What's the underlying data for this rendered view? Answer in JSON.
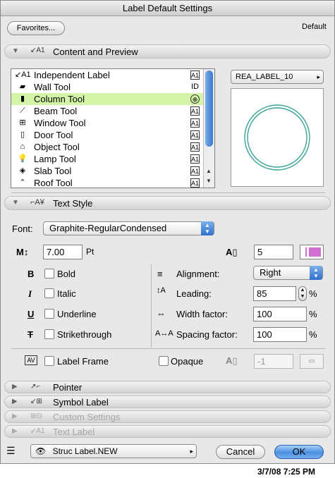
{
  "window": {
    "title": "Label Default Settings"
  },
  "header": {
    "favorites_label": "Favorites...",
    "default_label": "Default"
  },
  "content_preview": {
    "title": "Content and Preview",
    "tools": [
      {
        "label": "Independent Label",
        "icon": "label-tool-icon",
        "right": "A1"
      },
      {
        "label": "Wall Tool",
        "icon": "wall-tool-icon",
        "right": "ID"
      },
      {
        "label": "Column Tool",
        "icon": "column-tool-icon",
        "right": "symbol"
      },
      {
        "label": "Beam Tool",
        "icon": "beam-tool-icon",
        "right": "A1"
      },
      {
        "label": "Window Tool",
        "icon": "window-tool-icon",
        "right": "A1"
      },
      {
        "label": "Door Tool",
        "icon": "door-tool-icon",
        "right": "A1"
      },
      {
        "label": "Object Tool",
        "icon": "object-tool-icon",
        "right": "A1"
      },
      {
        "label": "Lamp Tool",
        "icon": "lamp-tool-icon",
        "right": "A1"
      },
      {
        "label": "Slab Tool",
        "icon": "slab-tool-icon",
        "right": "A1"
      },
      {
        "label": "Roof Tool",
        "icon": "roof-tool-icon",
        "right": "A1"
      }
    ],
    "selected_tool": "Column Tool",
    "label_name": "REA_LABEL_10"
  },
  "text_style": {
    "title": "Text Style",
    "font_label": "Font:",
    "font_value": "Graphite-RegularCondensed",
    "size_value": "7.00",
    "size_unit": "Pt",
    "pen_value": "5",
    "pen_color": "#d070d0",
    "bold_label": "Bold",
    "italic_label": "Italic",
    "underline_label": "Underline",
    "strike_label": "Strikethrough",
    "alignment_label": "Alignment:",
    "alignment_value": "Right",
    "leading_label": "Leading:",
    "leading_value": "85",
    "width_label": "Width factor:",
    "width_value": "100",
    "spacing_label": "Spacing factor:",
    "spacing_value": "100",
    "percent": "%",
    "label_frame_label": "Label Frame",
    "opaque_label": "Opaque",
    "opaque_value": "-1"
  },
  "sections": {
    "pointer": "Pointer",
    "symbol_label": "Symbol Label",
    "custom_settings": "Custom Settings",
    "text_label": "Text Label"
  },
  "footer": {
    "layer_value": "Struc Label.NEW",
    "cancel_label": "Cancel",
    "ok_label": "OK"
  },
  "status": {
    "clock": "3/7/08 7:25 PM"
  }
}
